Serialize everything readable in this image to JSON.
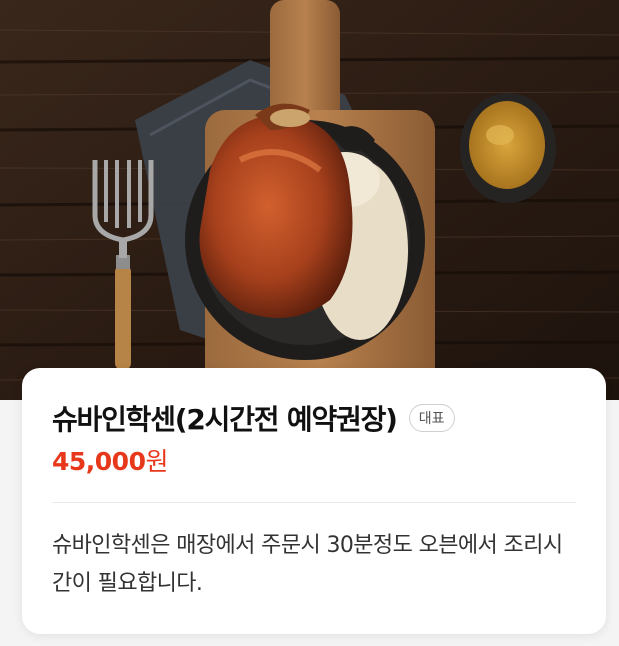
{
  "menu_item": {
    "name": "슈바인학센(2시간전 예약권장)",
    "badge": "대표",
    "price_amount": "45,000",
    "price_unit": "원",
    "description": "슈바인학센은 매장에서 주문시 30분정도 오븐에서 조리시간이 필요합니다."
  },
  "colors": {
    "price": "#e8381c",
    "title": "#111111",
    "description": "#333333"
  }
}
